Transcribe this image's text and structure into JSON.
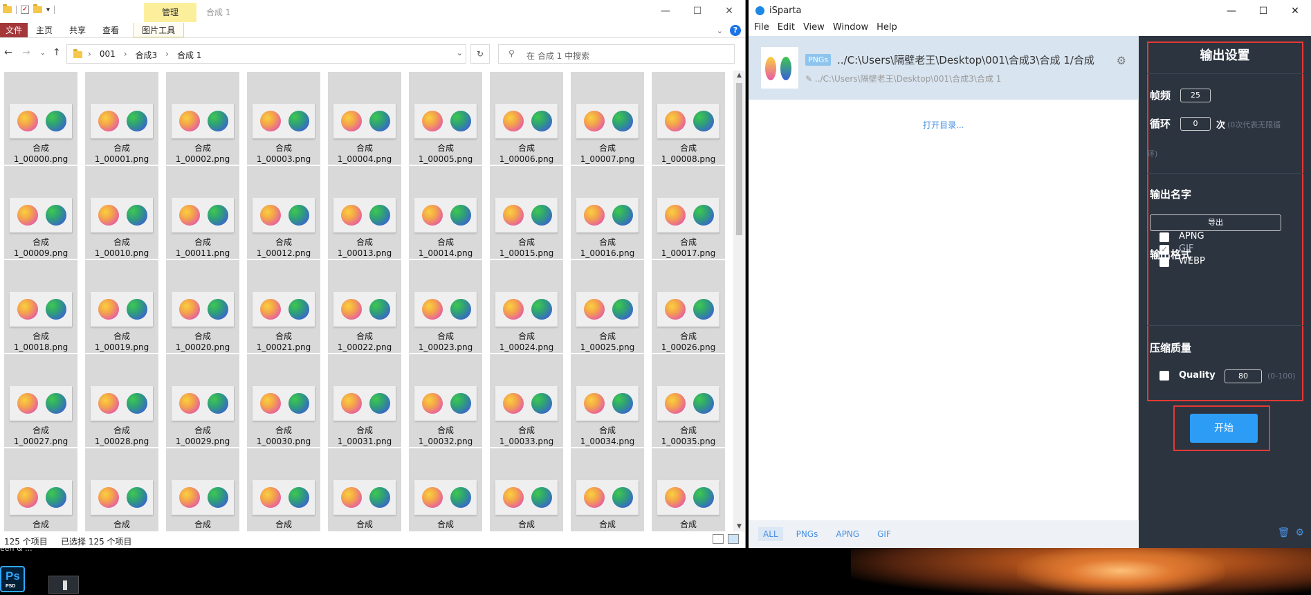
{
  "desktop": {
    "label": "een & ...",
    "ps_icon": {
      "text": "Ps",
      "sub": "PSD"
    }
  },
  "explorer": {
    "manage_tab": "管理",
    "window_title": "合成 1",
    "ribbon_tabs": [
      "文件",
      "主页",
      "共享",
      "查看",
      "图片工具"
    ],
    "breadcrumb": [
      "001",
      "合成3",
      "合成 1"
    ],
    "search_placeholder": "在 合成 1 中搜索",
    "status_count": "125 个项目",
    "status_selected": "已选择 125 个项目",
    "file_prefix": "合成",
    "files": [
      "1_00000.png",
      "1_00001.png",
      "1_00002.png",
      "1_00003.png",
      "1_00004.png",
      "1_00005.png",
      "1_00006.png",
      "1_00007.png",
      "1_00008.png",
      "1_00009.png",
      "1_00010.png",
      "1_00011.png",
      "1_00012.png",
      "1_00013.png",
      "1_00014.png",
      "1_00015.png",
      "1_00016.png",
      "1_00017.png",
      "1_00018.png",
      "1_00019.png",
      "1_00020.png",
      "1_00021.png",
      "1_00022.png",
      "1_00023.png",
      "1_00024.png",
      "1_00025.png",
      "1_00026.png",
      "1_00027.png",
      "1_00028.png",
      "1_00029.png",
      "1_00030.png",
      "1_00031.png",
      "1_00032.png",
      "1_00033.png",
      "1_00034.png",
      "1_00035.png",
      "",
      "",
      "",
      "",
      "",
      "",
      "",
      "",
      ""
    ]
  },
  "isparta": {
    "app_name": "iSparta",
    "menu": [
      "File",
      "Edit",
      "View",
      "Window",
      "Help"
    ],
    "item": {
      "badge": "PNGs",
      "path": "../C:\\Users\\隔壁老王\\Desktop\\001\\合成3\\合成 1/合成",
      "subpath": "../C:\\Users\\隔壁老王\\Desktop\\001\\合成3\\合成 1"
    },
    "open_dir": "打开目录...",
    "filters": [
      "ALL",
      "PNGs",
      "APNG",
      "GIF"
    ],
    "settings": {
      "title": "输出设置",
      "fps_label": "帧频",
      "fps_value": "25",
      "loop_label": "循环",
      "loop_value": "0",
      "loop_unit": "次",
      "loop_hint": "(0次代表无限循",
      "loop_hint2": "环)",
      "name_label": "输出名字",
      "export_button": "导出",
      "format_label": "输出格式",
      "formats": [
        {
          "name": "APNG",
          "checked": false
        },
        {
          "name": "GIF",
          "checked": true
        },
        {
          "name": "WEBP",
          "checked": false
        }
      ],
      "quality_section": "压缩质量",
      "quality_label": "Quality",
      "quality_value": "80",
      "quality_hint": "(0-100)",
      "start_button": "开始"
    }
  }
}
